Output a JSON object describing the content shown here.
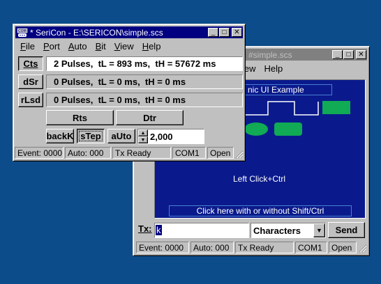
{
  "colors": {
    "desktop": "#0d4c8a",
    "canvas": "#0a1a8c",
    "shape_green": "#11aa55",
    "title_active": "#000080",
    "title_inactive": "#808080"
  },
  "back_window": {
    "title": "#simple.scs",
    "title_prefix_hidden": "* SeriCon - E:\\SERICON\\",
    "menu_visible": [
      "iew",
      "Help"
    ],
    "canvas": {
      "heading": "nic UI Example",
      "center_text": "Left Click+Ctrl",
      "bottom_button": "Click here with or without Shift/Ctrl"
    },
    "tx_label": "Tx:",
    "tx_value": "k",
    "mode_select": "Characters",
    "send_label": "Send",
    "status": {
      "events": "Event: 0000",
      "auto": "Auto: 000",
      "tx": "Tx Ready",
      "port": "COM1",
      "state": "Open"
    }
  },
  "front_window": {
    "title": "* SeriCon - E:\\SERICON\\simple.scs",
    "menu": [
      "File",
      "Port",
      "Auto",
      "Bit",
      "View",
      "Help"
    ],
    "signals": [
      {
        "label": "Cts",
        "value": "2 Pulses,  tL = 893 ms,  tH = 57672 ms",
        "active": true
      },
      {
        "label": "dSr",
        "value": "0 Pulses,  tL = 0 ms,  tH = 0 ms",
        "active": false
      },
      {
        "label": "rLsd",
        "value": "0 Pulses,  tL = 0 ms,  tH = 0 ms",
        "active": false
      }
    ],
    "rts_label": "Rts",
    "dtr_label": "Dtr",
    "back_label": "backK",
    "step_label": "sTep",
    "auto_label": "aUto",
    "interval_value": "2,000",
    "status": {
      "events": "Event: 0000",
      "auto": "Auto: 000",
      "tx": "Tx Ready",
      "port": "COM1",
      "state": "Open"
    }
  }
}
